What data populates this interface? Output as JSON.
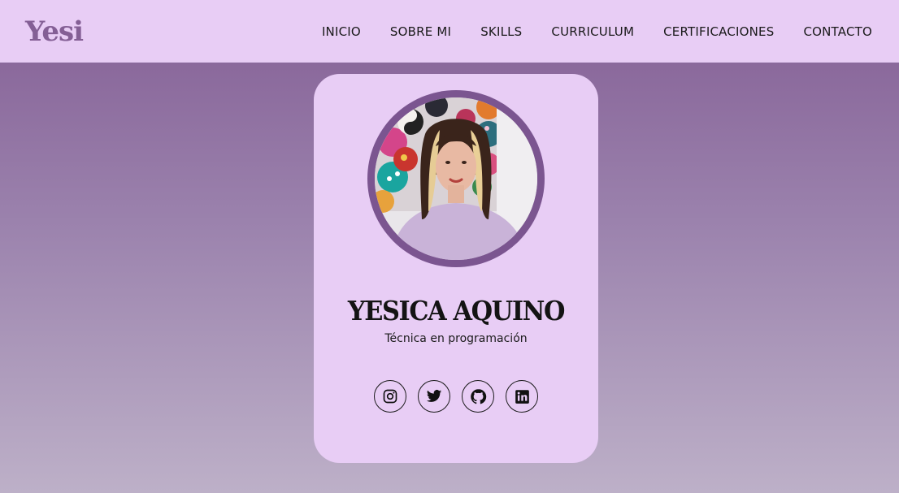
{
  "header": {
    "logo": "Yesi",
    "nav": [
      {
        "label": "INICIO"
      },
      {
        "label": "SOBRE MI"
      },
      {
        "label": "SKILLS"
      },
      {
        "label": "CURRICULUM"
      },
      {
        "label": "CERTIFICACIONES"
      },
      {
        "label": "CONTACTO"
      }
    ]
  },
  "profile": {
    "name": "YESICA AQUINO",
    "title": "Técnica en programación",
    "photo_alt": "Yesica Aquino profile photo"
  },
  "socials": [
    {
      "icon": "instagram-icon"
    },
    {
      "icon": "twitter-icon"
    },
    {
      "icon": "github-icon"
    },
    {
      "icon": "linkedin-icon"
    }
  ],
  "colors": {
    "nav_background": "#e8cdf5",
    "card_background": "#e8cdf5",
    "accent_purple": "#845f95",
    "gradient_top": "#845f95",
    "gradient_bottom": "#bdb0c8"
  }
}
